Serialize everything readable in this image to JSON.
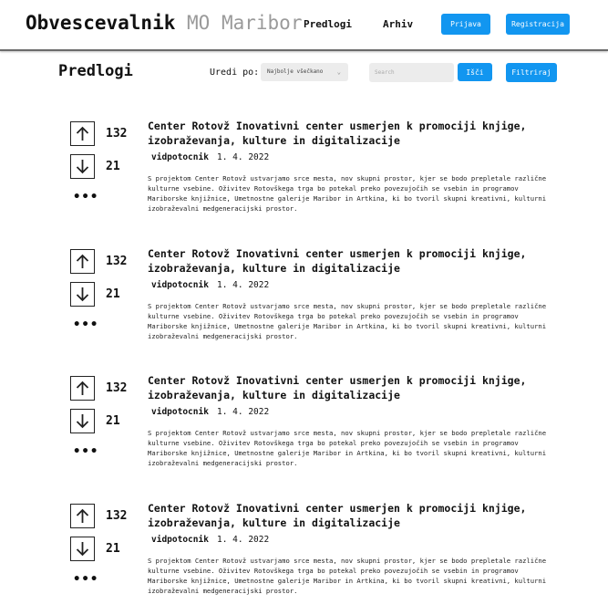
{
  "header": {
    "brand_primary": "Obvescevalnik",
    "brand_secondary": "MO Maribor",
    "nav": {
      "proposals": "Predlogi",
      "archive": "Arhiv"
    },
    "login_label": "Prijava",
    "register_label": "Registracija"
  },
  "colors": {
    "accent": "#1296f0",
    "muted_brand": "#9a9a9a"
  },
  "toolbar": {
    "title": "Predlogi",
    "sort_label": "Uredi po:",
    "sort_value": "Najbolje všečkano",
    "search_placeholder": "Search",
    "search_button": "Išči",
    "filter_button": "Filtriraj"
  },
  "posts": [
    {
      "upvotes": "132",
      "downvotes": "21",
      "more": "•••",
      "title": "Center Rotovž Inovativni center usmerjen k promociji knjige, izobraževanja, kulture in digitalizacije",
      "author": "vidpotocnik",
      "date": "1. 4. 2022",
      "excerpt": "S projektom Center Rotovž ustvarjamo srce mesta, nov skupni prostor, kjer se bodo prepletale različne kulturne vsebine. Oživitev Rotovškega trga bo potekal preko povezujočih se vsebin in programov Mariborske knjižnice, Umetnostne galerije Maribor in Artkina, ki bo tvoril skupni kreativni, kulturni izobraževalni medgeneracijski prostor."
    },
    {
      "upvotes": "132",
      "downvotes": "21",
      "more": "•••",
      "title": "Center Rotovž Inovativni center usmerjen k promociji knjige, izobraževanja, kulture in digitalizacije",
      "author": "vidpotocnik",
      "date": "1. 4. 2022",
      "excerpt": "S projektom Center Rotovž ustvarjamo srce mesta, nov skupni prostor, kjer se bodo prepletale različne kulturne vsebine. Oživitev Rotovškega trga bo potekal preko povezujočih se vsebin in programov Mariborske knjižnice, Umetnostne galerije Maribor in Artkina, ki bo tvoril skupni kreativni, kulturni izobraževalni medgeneracijski prostor."
    },
    {
      "upvotes": "132",
      "downvotes": "21",
      "more": "•••",
      "title": "Center Rotovž Inovativni center usmerjen k promociji knjige, izobraževanja, kulture in digitalizacije",
      "author": "vidpotocnik",
      "date": "1. 4. 2022",
      "excerpt": "S projektom Center Rotovž ustvarjamo srce mesta, nov skupni prostor, kjer se bodo prepletale različne kulturne vsebine. Oživitev Rotovškega trga bo potekal preko povezujočih se vsebin in programov Mariborske knjižnice, Umetnostne galerije Maribor in Artkina, ki bo tvoril skupni kreativni, kulturni izobraževalni medgeneracijski prostor."
    },
    {
      "upvotes": "132",
      "downvotes": "21",
      "more": "•••",
      "title": "Center Rotovž Inovativni center usmerjen k promociji knjige, izobraževanja, kulture in digitalizacije",
      "author": "vidpotocnik",
      "date": "1. 4. 2022",
      "excerpt": "S projektom Center Rotovž ustvarjamo srce mesta, nov skupni prostor, kjer se bodo prepletale različne kulturne vsebine. Oživitev Rotovškega trga bo potekal preko povezujočih se vsebin in programov Mariborske knjižnice, Umetnostne galerije Maribor in Artkina, ki bo tvoril skupni kreativni, kulturni izobraževalni medgeneracijski prostor."
    }
  ]
}
